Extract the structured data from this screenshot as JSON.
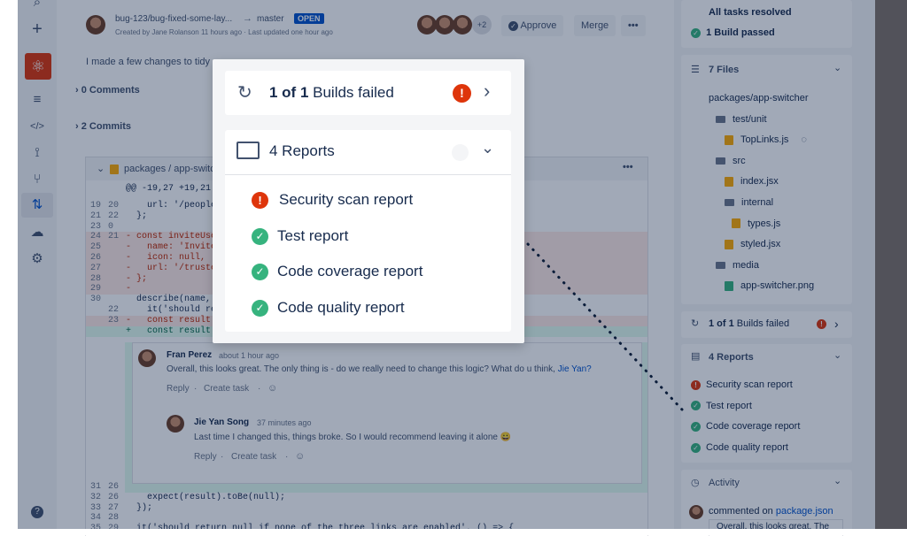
{
  "pr": {
    "branch": "bug-123/bug-fixed-some-lay...",
    "arrow": "→",
    "target": "master",
    "status": "OPEN",
    "meta": "Created by Jane Rolanson 11 hours ago · Last updated one hour ago",
    "more_reviewers": "+2",
    "approve_label": "Approve",
    "merge_label": "Merge",
    "more_label": "•••",
    "description": "I made a few changes to tidy",
    "comments_toggle": "0 Comments",
    "commits_toggle": "2 Commits"
  },
  "diff": {
    "file_path": "packages / app-switc",
    "hunk_header": "@@ -19,27 +19,21 @@",
    "lines": [
      {
        "old": "19",
        "new": "20",
        "text": "    url: '/people',",
        "type": "ctx"
      },
      {
        "old": "21",
        "new": "22",
        "text": "  };",
        "type": "ctx"
      },
      {
        "old": "23",
        "new": "0",
        "text": "",
        "type": "ctx"
      },
      {
        "old": "24",
        "new": "21",
        "text": "- const inviteUser",
        "type": "del"
      },
      {
        "old": "25",
        "new": "",
        "text": "-   name: 'Invite U",
        "type": "del"
      },
      {
        "old": "26",
        "new": "",
        "text": "-   icon: null,",
        "type": "del"
      },
      {
        "old": "27",
        "new": "",
        "text": "-   url: '/trusted-",
        "type": "del"
      },
      {
        "old": "28",
        "new": "",
        "text": "- };",
        "type": "del"
      },
      {
        "old": "29",
        "new": "",
        "text": "-",
        "type": "del"
      },
      {
        "old": "30",
        "new": "",
        "text": "  describe(name, (",
        "type": "ctx"
      },
      {
        "old": "",
        "new": "22",
        "text": "    it('should ret",
        "type": "ctx"
      },
      {
        "old": "",
        "new": "23",
        "text": "-   const result =",
        "type": "del"
      },
      {
        "old": "",
        "new": "",
        "text": "+   const result =",
        "type": "add"
      }
    ],
    "bottom_lines": [
      {
        "old": "31",
        "new": "26",
        "text": ""
      },
      {
        "old": "32",
        "new": "26",
        "text": "    expect(result).toBe(null);"
      },
      {
        "old": "33",
        "new": "27",
        "text": "  });"
      },
      {
        "old": "34",
        "new": "28",
        "text": ""
      },
      {
        "old": "35",
        "new": "29",
        "text": "  it('should return null if none of the three links are enabled', () => {"
      }
    ]
  },
  "thread": {
    "c1_author": "Fran Perez",
    "c1_time": "about 1 hour ago",
    "c1_text": "Overall, this looks great. The only thing is - do we really need to change this logic? What do u think, ",
    "c1_mention": "Jie Yan?",
    "reply": "Reply",
    "dot": "·",
    "create_task": "Create task",
    "c2_author": "Jie Yan Song",
    "c2_time": "37 minutes ago",
    "c2_text": "Last time I changed this, things broke. So I would recommend leaving it alone",
    "c2_emoji": "😀"
  },
  "right": {
    "tasks": "All tasks resolved",
    "build_passed": "1 Build passed",
    "files_header": "7 Files",
    "files": [
      {
        "name": "packages/app-switcher",
        "kind": "text",
        "depth": 0
      },
      {
        "name": "test/unit",
        "kind": "folder",
        "depth": 1
      },
      {
        "name": "TopLinks.js",
        "kind": "js",
        "depth": 2
      },
      {
        "name": "src",
        "kind": "folder",
        "depth": 1
      },
      {
        "name": "index.jsx",
        "kind": "js",
        "depth": 2
      },
      {
        "name": "internal",
        "kind": "folder",
        "depth": 2
      },
      {
        "name": "types.js",
        "kind": "js",
        "depth": 3
      },
      {
        "name": "styled.jsx",
        "kind": "js",
        "depth": 2
      },
      {
        "name": "media",
        "kind": "folder",
        "depth": 1
      },
      {
        "name": "app-switcher.png",
        "kind": "png",
        "depth": 2
      }
    ],
    "builds_pre": "1 of 1",
    "builds_post": " Builds failed",
    "reports_header": "4 Reports",
    "reports": [
      {
        "label": "Security scan report",
        "status": "error"
      },
      {
        "label": "Test report",
        "status": "ok"
      },
      {
        "label": "Code coverage report",
        "status": "ok"
      },
      {
        "label": "Code quality report",
        "status": "ok"
      }
    ],
    "activity": "Activity",
    "activity_item_pre": "commented on ",
    "activity_item_link": "package.json",
    "activity_preview": "Overall, this looks great. The"
  },
  "popup": {
    "builds_bold": "1 of 1",
    "builds_rest": " Builds failed",
    "reports_header": "4 Reports",
    "reports": [
      {
        "label": "Security scan report",
        "status": "error"
      },
      {
        "label": "Test report",
        "status": "ok"
      },
      {
        "label": "Code coverage report",
        "status": "ok"
      },
      {
        "label": "Code quality report",
        "status": "ok"
      }
    ]
  },
  "icons": {
    "check": "✓",
    "error": "!",
    "chevron_right": "›",
    "chevron_down": "⌄"
  },
  "colors": {
    "error": "#de350b",
    "success": "#36b37e",
    "brand": "#0052cc"
  }
}
